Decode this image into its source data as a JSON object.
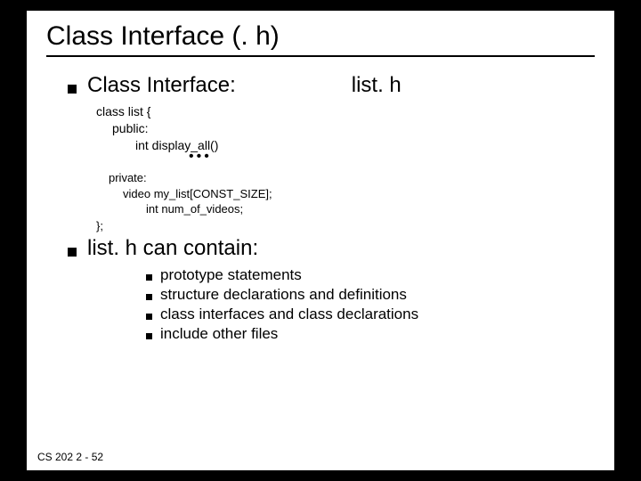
{
  "title": "Class Interface  (. h)",
  "section1": {
    "heading": "Class Interface:",
    "filename": "list. h",
    "code_top": {
      "l1": "class list {",
      "l2": "public:",
      "l3": "int display_all()"
    },
    "dots": "•••",
    "code_bottom": {
      "l1": "private:",
      "l2": "video my_list[CONST_SIZE];",
      "l3": "int num_of_videos;"
    },
    "brace": "};"
  },
  "section2": {
    "heading": "list. h can contain:",
    "items": [
      "prototype statements",
      "structure declarations and definitions",
      "class interfaces and class declarations",
      "include other files"
    ]
  },
  "footer": "CS 202   2 - 52"
}
